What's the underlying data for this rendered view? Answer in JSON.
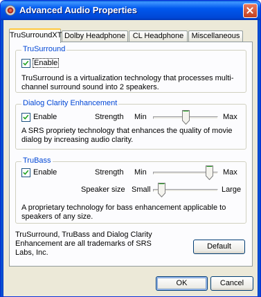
{
  "window": {
    "title": "Advanced Audio Properties",
    "close_label": "×"
  },
  "tabs": [
    {
      "label": "TruSurroundXT",
      "active": true
    },
    {
      "label": "Dolby Headphone",
      "active": false
    },
    {
      "label": "CL Headphone",
      "active": false
    },
    {
      "label": "Miscellaneous",
      "active": false
    }
  ],
  "trusurround": {
    "title": "TruSurround",
    "enable_label": "Enable",
    "enabled": true,
    "description": "TruSurround is a virtualization technology that processes multi-channel surround sound into 2 speakers."
  },
  "dialog_clarity": {
    "title": "Dialog Clarity Enhancement",
    "enable_label": "Enable",
    "enabled": true,
    "strength_label": "Strength",
    "min_label": "Min",
    "max_label": "Max",
    "strength_level": 0.5,
    "description": "A SRS propriety technology that enhances the quality of movie dialog by increasing audio clarity."
  },
  "trubass": {
    "title": "TruBass",
    "enable_label": "Enable",
    "enabled": true,
    "strength_label": "Strength",
    "min_label": "Min",
    "max_label": "Max",
    "strength_level": 0.85,
    "speaker_size_label": "Speaker size",
    "small_label": "Small",
    "large_label": "Large",
    "speaker_size_level": 0.1,
    "description": "A proprietary technology for bass enhancement applicable to speakers of any size."
  },
  "footer": {
    "trademark": "TruSurround, TruBass and Dialog Clarity Enhancement are all trademarks of SRS Labs, Inc.",
    "default_label": "Default"
  },
  "buttons": {
    "ok_label": "OK",
    "cancel_label": "Cancel"
  },
  "colors": {
    "titlebar": "#0058ee",
    "group_title": "#0046d5",
    "tab_highlight": "#ffc83c",
    "dialog_face": "#ece9d8"
  }
}
